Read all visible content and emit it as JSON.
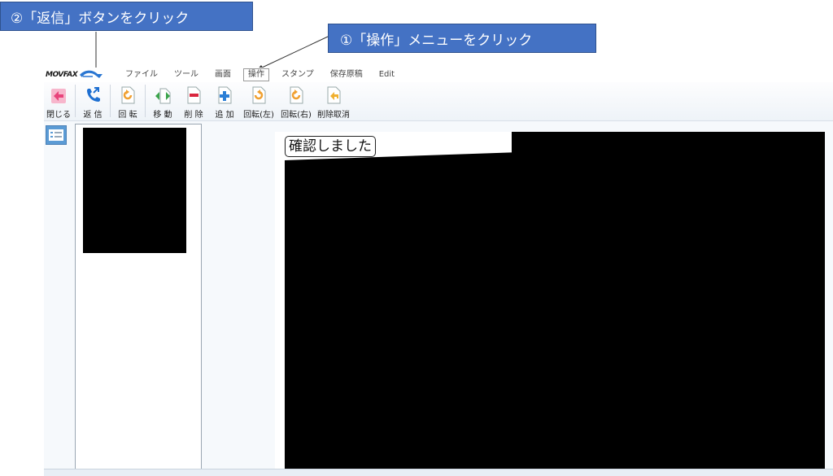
{
  "annotations": {
    "step1": "①「操作」メニューをクリック",
    "step2": "②「返信」ボタンをクリック"
  },
  "app": {
    "logo_text": "MOVFAX",
    "logo_icon": "logo-swoosh-icon"
  },
  "menu": {
    "items": [
      {
        "label": "ファイル"
      },
      {
        "label": "ツール"
      },
      {
        "label": "画面"
      },
      {
        "label": "操作",
        "active": true
      },
      {
        "label": "スタンプ"
      },
      {
        "label": "保存原稿"
      },
      {
        "label": "Edit"
      }
    ]
  },
  "toolbar": {
    "close": "閉じる",
    "reply": "返 信",
    "rotate": "回 転",
    "move": "移 動",
    "delete": "削 除",
    "add": "追 加",
    "rotate_left": "回転(左)",
    "rotate_right": "回転(右)",
    "undo_delete": "削除取消"
  },
  "document": {
    "stamp_text": "確認しました"
  },
  "colors": {
    "callout_bg": "#4472c4",
    "close_icon": "#e8437b",
    "reply_icon": "#1e6fd1",
    "rotate_icon": "#f0a030",
    "move_icon": "#3aa34a",
    "delete_icon": "#d9263e",
    "add_icon": "#2c7fd6"
  }
}
